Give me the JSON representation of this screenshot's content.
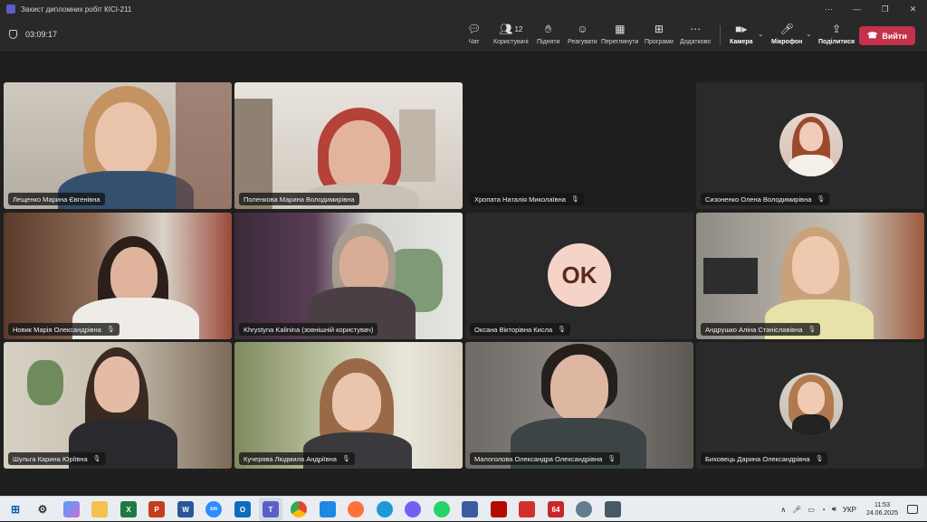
{
  "window": {
    "title": "Захист дипломних робіт КІСІ-211"
  },
  "toolbar": {
    "timer": "03:09:17",
    "chat": "Чат",
    "people": "Користувачі",
    "people_count": "12",
    "raise": "Підняти",
    "react": "Реагувати",
    "view": "Переглянути",
    "apps": "Програми",
    "more": "Додатково",
    "camera": "Камера",
    "mic": "Мікрофон",
    "share": "Поділитися",
    "leave": "Вийти"
  },
  "participants": [
    {
      "name": "Лещенко Марина Євгенівна",
      "muted": false
    },
    {
      "name": "Поленкова Марина Володимирівна",
      "muted": false
    },
    {
      "name": "Хропата Наталія Миколаївна",
      "muted": true
    },
    {
      "name": "Сизоненко Олена Володимирівна",
      "muted": true
    },
    {
      "name": "Новик Марія Олександрівна",
      "muted": true
    },
    {
      "name": "Khrystyna Kalinina (зовнішній користувач)",
      "muted": false
    },
    {
      "name": "Оксана Вікторівна Кисла",
      "muted": true,
      "initials": "OK"
    },
    {
      "name": "Андрушко Аліна Станіславівна",
      "muted": true
    },
    {
      "name": "Шульга Карина Юріївна",
      "muted": true
    },
    {
      "name": "Кучерява Людмила Андріївна",
      "muted": true
    },
    {
      "name": "Малоголова Олександра Олександрівна",
      "muted": true
    },
    {
      "name": "Биховець Дарина Олександрівна",
      "muted": true
    }
  ],
  "taskbar": {
    "lang": "УКР",
    "time": "11:53",
    "date": "24.06.2025",
    "badge_64": "64"
  },
  "colors": {
    "accent": "#5b5fc7",
    "leave": "#c4314b",
    "active_outline": "#8a8ee0"
  }
}
